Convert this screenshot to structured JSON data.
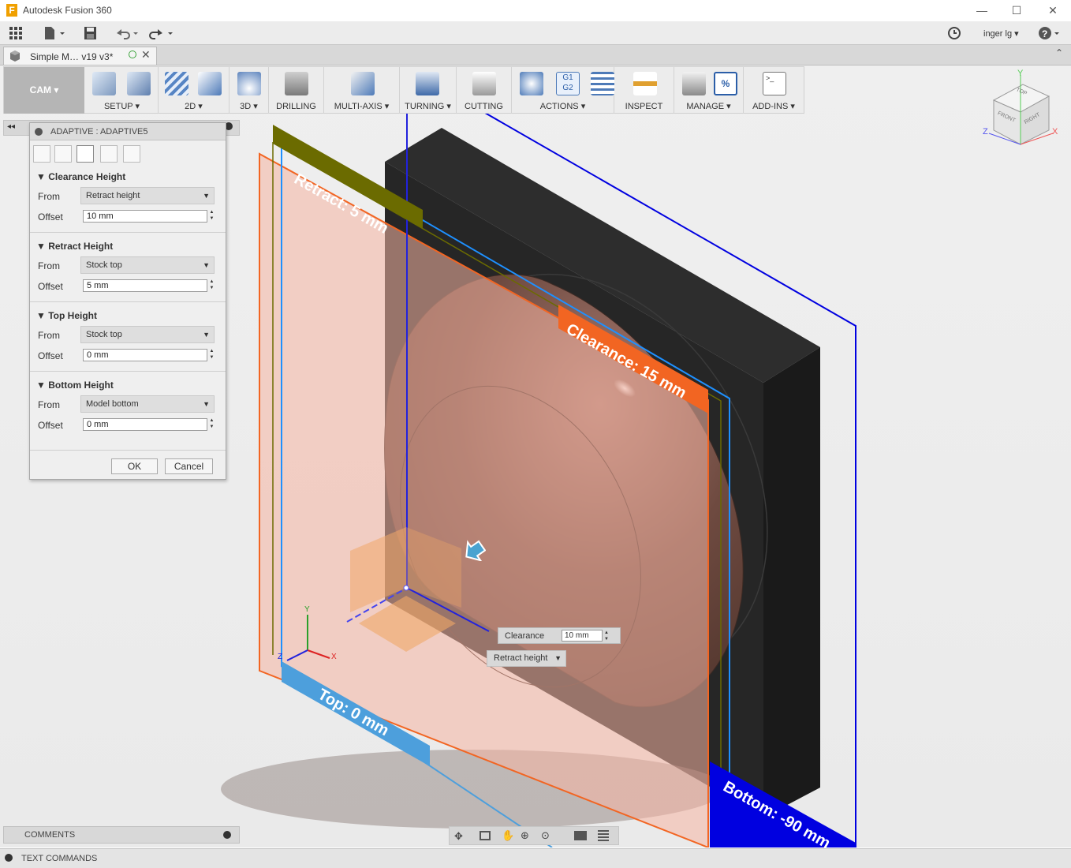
{
  "app": {
    "title": "Autodesk Fusion 360",
    "logo": "F"
  },
  "window_controls": {
    "minimize": "—",
    "maximize": "☐",
    "close": "✕"
  },
  "qat": {
    "user": "inger lg",
    "help": "?"
  },
  "document": {
    "tab_title": "Simple M… v19 v3*"
  },
  "toolbar": {
    "workspace": "CAM",
    "groups": [
      "SETUP",
      "2D",
      "3D",
      "DRILLING",
      "MULTI-AXIS",
      "TURNING",
      "CUTTING",
      "ACTIONS",
      "INSPECT",
      "MANAGE",
      "ADD-INS"
    ],
    "actions_g1": "G1",
    "actions_g2": "G2",
    "manage_pct": "%",
    "addins_prompt": ">_"
  },
  "dialog": {
    "title": "ADAPTIVE : ADAPTIVE5",
    "sections": [
      {
        "title": "Clearance Height",
        "from_label": "From",
        "from_value": "Retract height",
        "offset_label": "Offset",
        "offset_value": "10 mm"
      },
      {
        "title": "Retract Height",
        "from_label": "From",
        "from_value": "Stock top",
        "offset_label": "Offset",
        "offset_value": "5 mm"
      },
      {
        "title": "Top Height",
        "from_label": "From",
        "from_value": "Stock top",
        "offset_label": "Offset",
        "offset_value": "0 mm"
      },
      {
        "title": "Bottom Height",
        "from_label": "From",
        "from_value": "Model bottom",
        "offset_label": "Offset",
        "offset_value": "0 mm"
      }
    ],
    "ok": "OK",
    "cancel": "Cancel"
  },
  "canvas": {
    "labels": {
      "retract": "Retract: 5 mm",
      "clearance": "Clearance: 15 mm",
      "top": "Top: 0 mm",
      "bottom": "Bottom: -90 mm"
    },
    "manipulator": {
      "label": "Clearance",
      "value": "10 mm",
      "from": "Retract height"
    },
    "triad": {
      "x": "X",
      "y": "Y",
      "z": "Z"
    }
  },
  "viewcube": {
    "top": "TOP",
    "front": "FRONT",
    "right": "RIGHT",
    "x": "X",
    "y": "Y",
    "z": "Z"
  },
  "panels": {
    "comments": "COMMENTS",
    "text_commands": "TEXT COMMANDS"
  },
  "colors": {
    "retract": "#6b6b00",
    "clearance": "#f26522",
    "top": "#4d9fdc",
    "bottom": "#0000e0",
    "stock": "#1e1e1e",
    "part": "#6b4238"
  }
}
